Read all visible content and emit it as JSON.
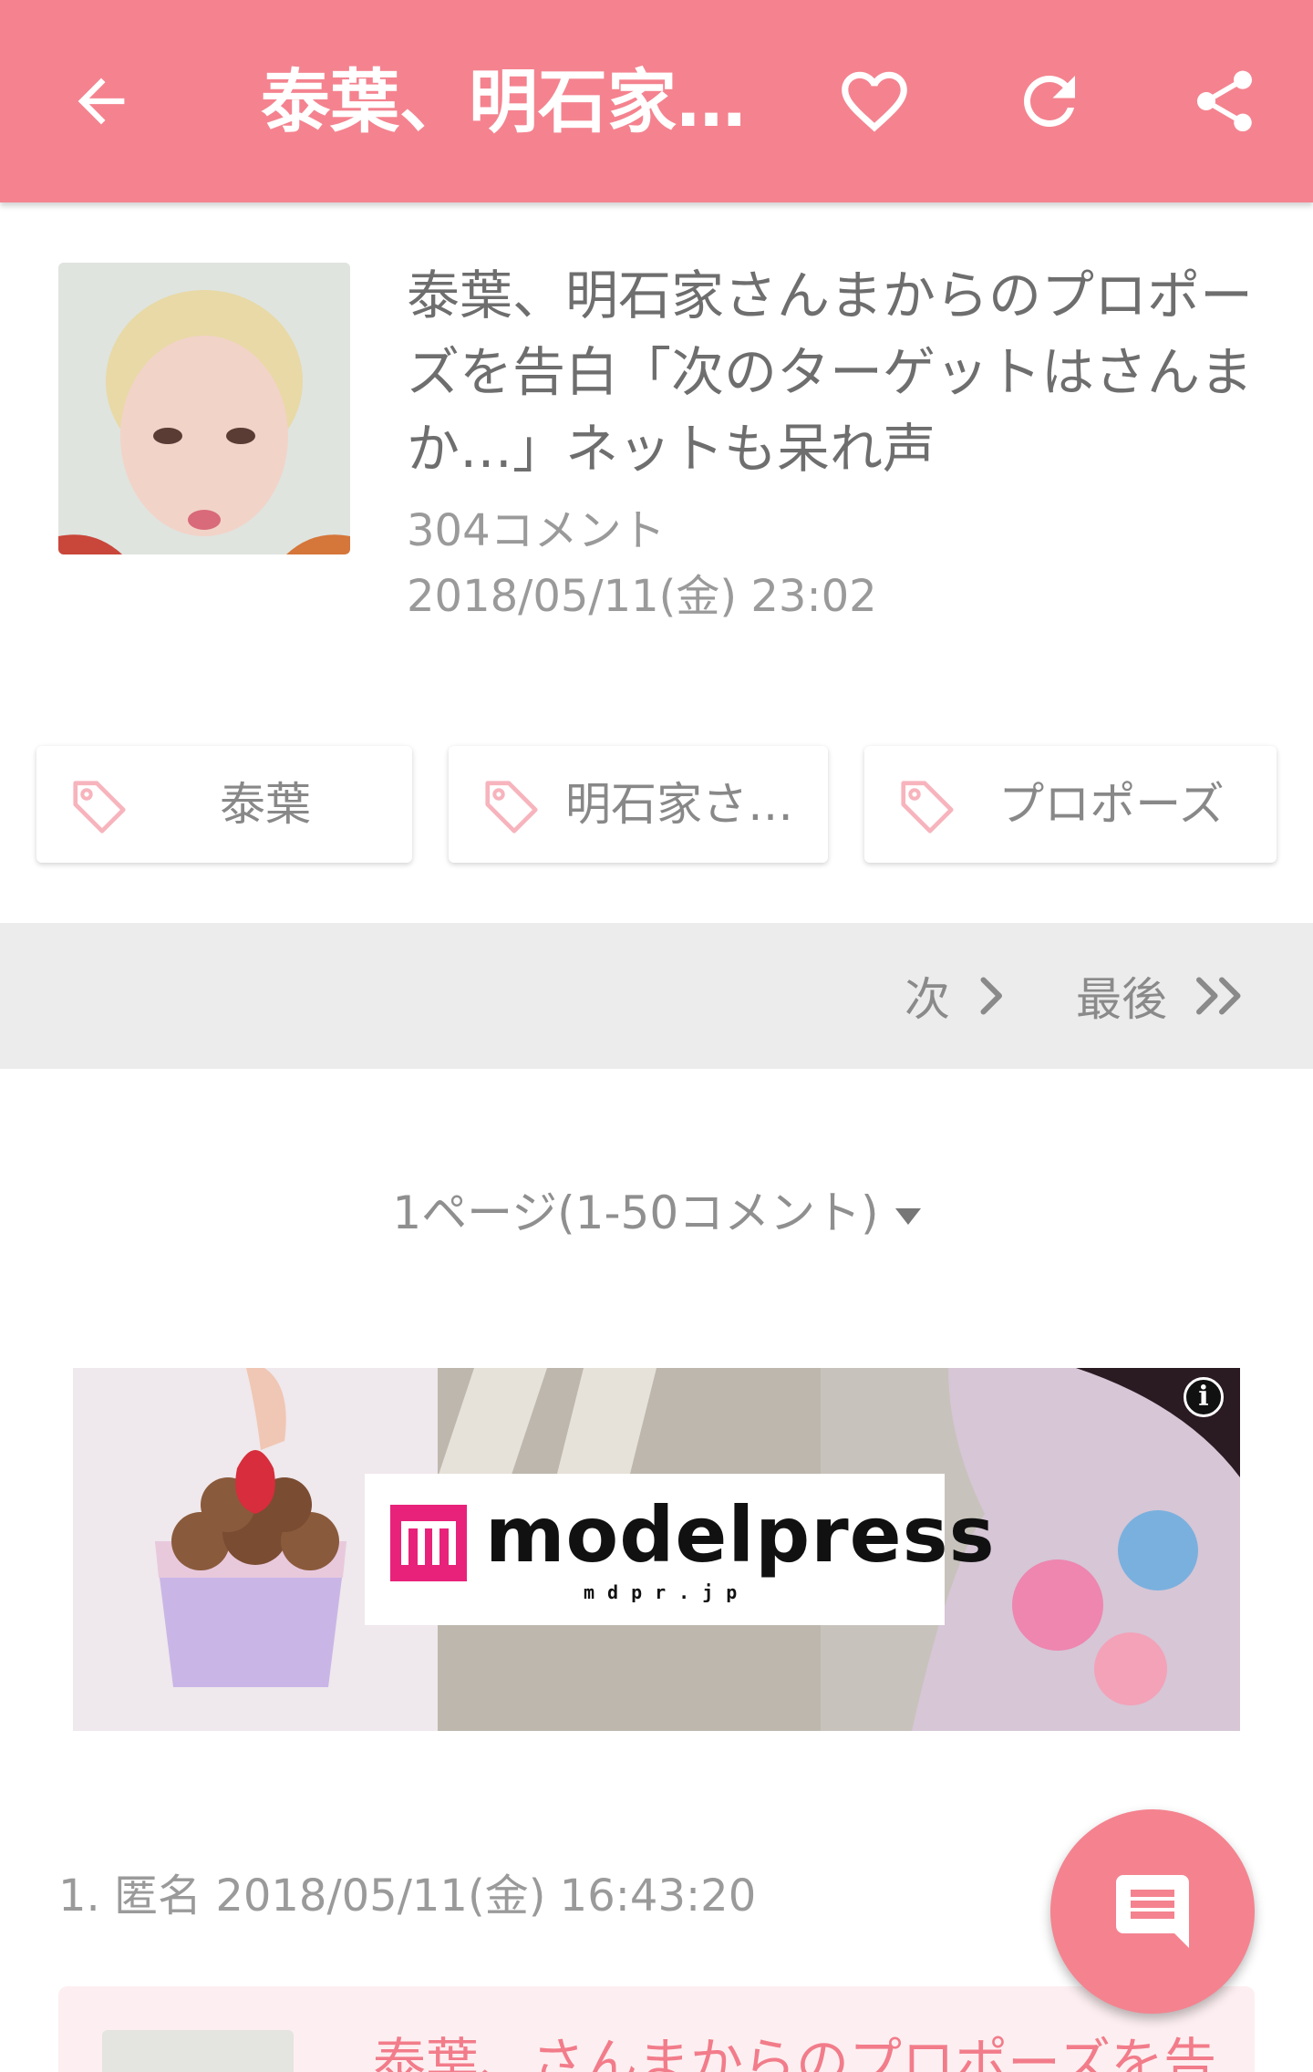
{
  "appbar": {
    "title": "泰葉、明石家…",
    "back_icon": "arrow-left-icon",
    "favorite_icon": "heart-icon",
    "refresh_icon": "refresh-icon",
    "share_icon": "share-icon",
    "background_color": "#f4838f"
  },
  "article": {
    "title": "泰葉、明石家さんまからのプロポーズを告白「次のターゲットはさんまか…」ネットも呆れ声",
    "comment_count": "304コメント",
    "date": "2018/05/11(金) 23:02"
  },
  "tags": [
    {
      "label": "泰葉",
      "icon": "tag-icon"
    },
    {
      "label": "明石家さ…",
      "icon": "tag-icon"
    },
    {
      "label": "プロポーズ",
      "icon": "tag-icon"
    }
  ],
  "pager": {
    "next_label": "次",
    "last_label": "最後"
  },
  "page_select": {
    "label": "1ページ(1-50コメント)"
  },
  "ad": {
    "brand": "modelpress",
    "sub": "mdpr.jp",
    "info_label": "i"
  },
  "comment": {
    "header": "1. 匿名 2018/05/11(金) 16:43:20",
    "quote_title": "泰葉、さんまからのプロポーズを告"
  },
  "fab": {
    "icon": "comment-icon"
  }
}
